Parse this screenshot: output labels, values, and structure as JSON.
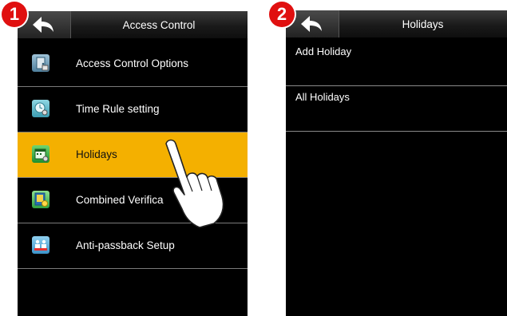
{
  "step1": {
    "badge": "1",
    "title": "Access Control",
    "items": [
      {
        "label": "Access Control Options",
        "icon": "door-options-icon",
        "selected": false
      },
      {
        "label": "Time Rule setting",
        "icon": "clock-gear-icon",
        "selected": false
      },
      {
        "label": "Holidays",
        "icon": "calendar-icon",
        "selected": true
      },
      {
        "label": "Combined Verification",
        "icon": "combined-verify-icon",
        "selected": false
      },
      {
        "label": "Anti-passback Setup",
        "icon": "anti-passback-icon",
        "selected": false
      }
    ],
    "visible_label_3": "Combined Verifica"
  },
  "step2": {
    "badge": "2",
    "title": "Holidays",
    "items": [
      {
        "label": "Add Holiday"
      },
      {
        "label": "All Holidays"
      }
    ]
  },
  "colors": {
    "selected_bg": "#f4b000",
    "badge_red": "#e01010",
    "screen_bg": "#000000"
  }
}
